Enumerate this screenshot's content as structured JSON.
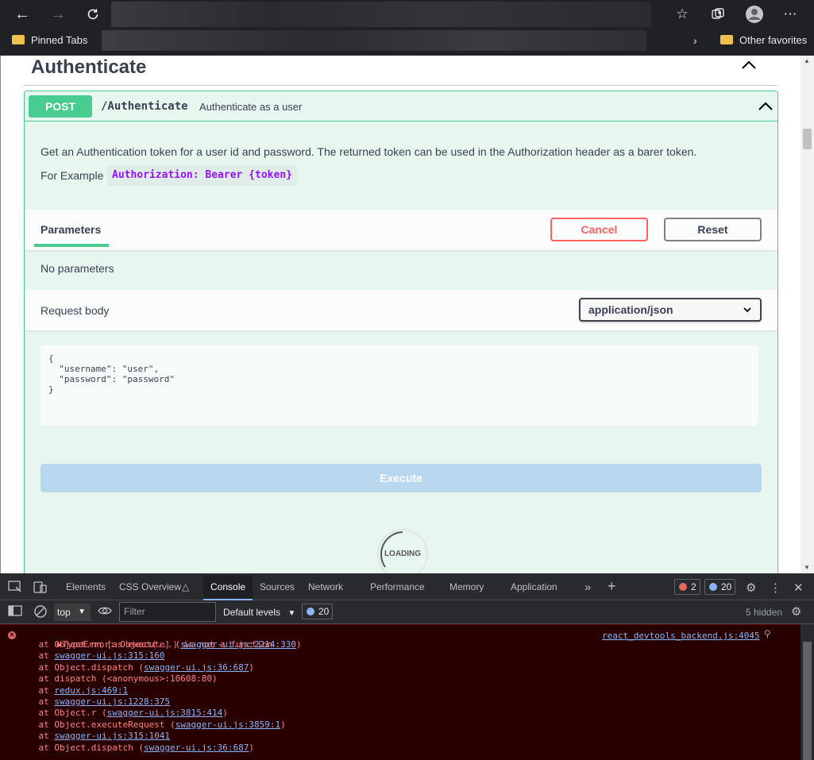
{
  "browser": {
    "bookmarks": {
      "pinned": "Pinned Tabs",
      "other": "Other favorites"
    }
  },
  "page": {
    "section_title": "Authenticate",
    "operation": {
      "method": "POST",
      "path": "/Authenticate",
      "summary": "Authenticate as a user",
      "description": "Get an Authentication token for a user id and password. The returned token can be used in the Authorization header as a barer token.",
      "example_label": "For Example",
      "example_code": "Authorization: Bearer {token}",
      "params_tab": "Parameters",
      "cancel_label": "Cancel",
      "reset_label": "Reset",
      "no_params": "No parameters",
      "request_body_label": "Request body",
      "content_type": "application/json",
      "body_text": "{\n  \"username\": \"user\",\n  \"password\": \"password\"\n}",
      "execute_label": "Execute",
      "loading_label": "LOADING"
    }
  },
  "devtools": {
    "tabs": [
      "Elements",
      "CSS Overview",
      "Console",
      "Sources",
      "Network",
      "Performance",
      "Memory",
      "Application"
    ],
    "active_tab": "Console",
    "error_count": "2",
    "info_count": "20",
    "context": "top",
    "filter_placeholder": "Filter",
    "levels": "Default levels",
    "issues_count": "20",
    "hidden": "5 hidden",
    "error_message": "TypeError: Object(...) is not a function",
    "error_source": "react_devtools_backend.js:4045",
    "stack": [
      {
        "prefix": "    at Object.nn [as execute] (",
        "link": "swagger-ui.js:2214:330",
        "suffix": ")"
      },
      {
        "prefix": "    at ",
        "link": "swagger-ui.js:315:160",
        "suffix": ""
      },
      {
        "prefix": "    at Object.dispatch (",
        "link": "swagger-ui.js:36:687",
        "suffix": ")"
      },
      {
        "prefix": "    at dispatch (<anonymous>:10608:80)",
        "link": "",
        "suffix": ""
      },
      {
        "prefix": "    at ",
        "link": "redux.js:469:1",
        "suffix": ""
      },
      {
        "prefix": "    at ",
        "link": "swagger-ui.js:1228:375",
        "suffix": ""
      },
      {
        "prefix": "    at Object.r (",
        "link": "swagger-ui.js:3815:414",
        "suffix": ")"
      },
      {
        "prefix": "    at Object.executeRequest (",
        "link": "swagger-ui.js:3859:1",
        "suffix": ")"
      },
      {
        "prefix": "    at ",
        "link": "swagger-ui.js:315:1041",
        "suffix": ""
      },
      {
        "prefix": "    at Object.dispatch (",
        "link": "swagger-ui.js:36:687",
        "suffix": ")"
      }
    ]
  }
}
